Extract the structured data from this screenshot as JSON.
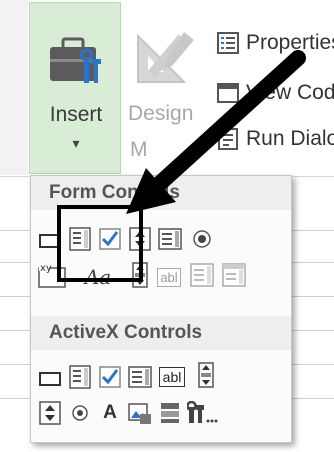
{
  "ribbon": {
    "insert_label": "Insert",
    "insert_caret": "▾",
    "design_label_line1": "Design",
    "design_label_line2": "M",
    "commands": [
      {
        "label": "Properties",
        "icon": "properties-icon"
      },
      {
        "label": "View Code",
        "icon": "view-code-icon"
      },
      {
        "label": "Run Dialog",
        "icon": "run-dialog-icon"
      }
    ]
  },
  "panel": {
    "form_controls_header": "Form Controls",
    "activex_controls_header": "ActiveX Controls",
    "form_text_label": "Aa",
    "form_textfield_label": "abl",
    "activex_textbox_label": "abl",
    "activex_label_label": "A"
  },
  "colors": {
    "insert_bg": "#d8ecd6",
    "checkbox_blue": "#2e73c4",
    "highlight_box": "#000000"
  }
}
